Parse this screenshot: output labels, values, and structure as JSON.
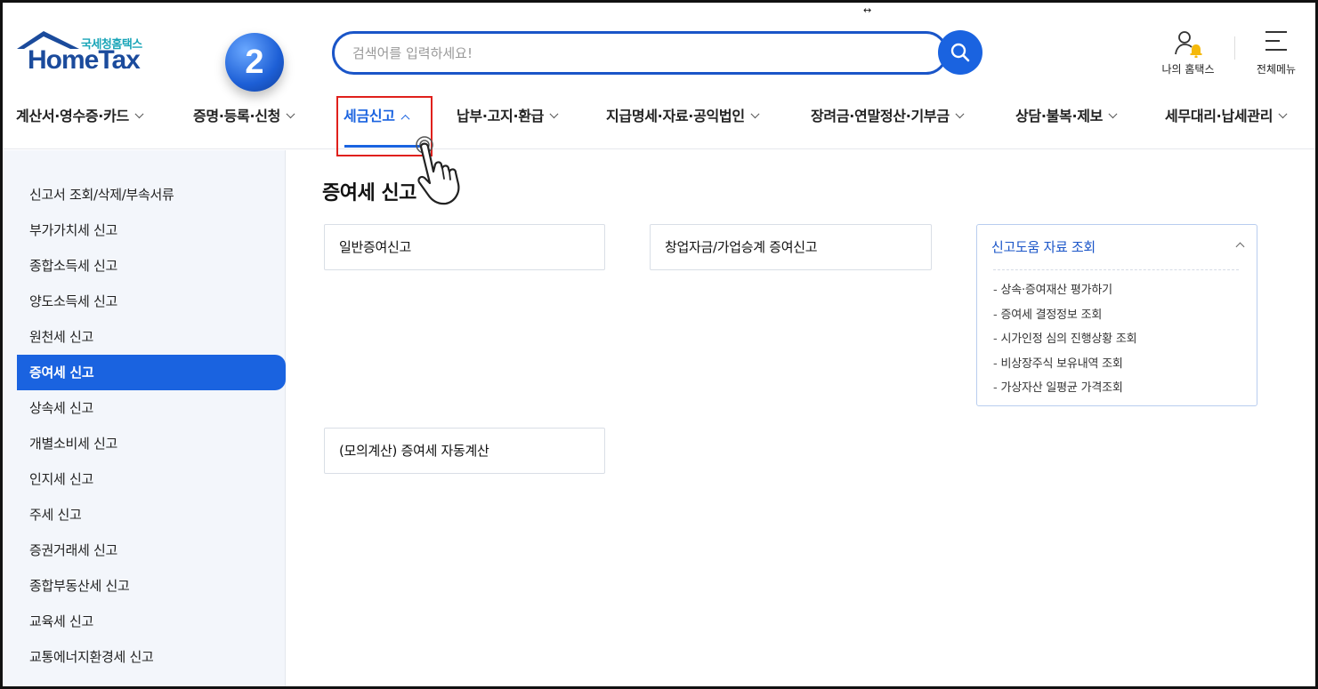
{
  "header": {
    "logo_kr": "국세청홈택스",
    "logo_en": "HomeTax",
    "step_badge": "2",
    "search_placeholder": "검색어를 입력하세요!",
    "my_hometax": "나의 홈택스",
    "all_menu": "전체메뉴"
  },
  "nav": {
    "items": [
      {
        "label": "계산서·영수증·카드"
      },
      {
        "label": "증명·등록·신청"
      },
      {
        "label": "세금신고",
        "active": true
      },
      {
        "label": "납부·고지·환급"
      },
      {
        "label": "지급명세·자료·공익법인"
      },
      {
        "label": "장려금·연말정산·기부금"
      },
      {
        "label": "상담·불복·제보"
      },
      {
        "label": "세무대리·납세관리"
      }
    ]
  },
  "sidebar": {
    "items": [
      {
        "label": "신고서 조회/삭제/부속서류"
      },
      {
        "label": "부가가치세 신고"
      },
      {
        "label": "종합소득세 신고"
      },
      {
        "label": "양도소득세 신고"
      },
      {
        "label": "원천세 신고"
      },
      {
        "label": "증여세 신고",
        "active": true
      },
      {
        "label": "상속세 신고"
      },
      {
        "label": "개별소비세 신고"
      },
      {
        "label": "인지세 신고"
      },
      {
        "label": "주세 신고"
      },
      {
        "label": "증권거래세 신고"
      },
      {
        "label": "종합부동산세 신고"
      },
      {
        "label": "교육세 신고"
      },
      {
        "label": "교통에너지환경세 신고"
      }
    ]
  },
  "main": {
    "title": "증여세 신고",
    "cards": [
      {
        "label": "일반증여신고"
      },
      {
        "label": "창업자금/가업승계 증여신고"
      },
      {
        "label": "(모의계산) 증여세 자동계산"
      }
    ],
    "help_panel": {
      "title": "신고도움 자료 조회",
      "links": [
        "상속·증여재산 평가하기",
        "증여세 결정정보 조회",
        "시가인정 심의 진행상황 조회",
        "비상장주식 보유내역 조회",
        "가상자산 일평균 가격조회"
      ]
    }
  },
  "colors": {
    "accent": "#1a63e0",
    "highlight_box": "#e0201c",
    "logo_blue": "#1b4b9c",
    "logo_teal": "#1aa5b8"
  }
}
